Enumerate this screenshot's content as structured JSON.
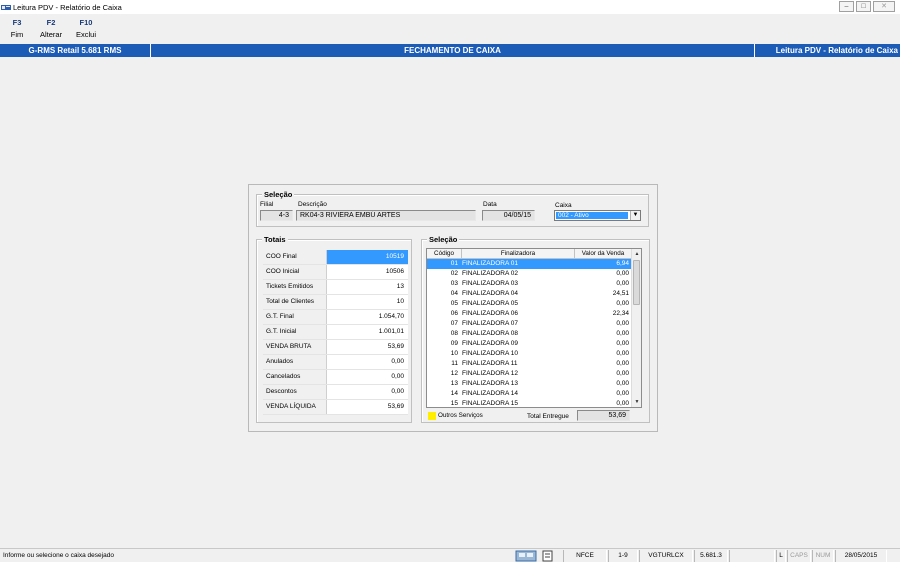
{
  "window": {
    "title": "Leitura PDV - Relatório de Caixa",
    "buttons": [
      "–",
      "□",
      "✕"
    ]
  },
  "toolbar": {
    "items": [
      {
        "key": "F3",
        "label": "Fim"
      },
      {
        "key": "F2",
        "label": "Alterar"
      },
      {
        "key": "F10",
        "label": "Exclui"
      }
    ]
  },
  "header": {
    "left": "G-RMS Retail 5.681 RMS",
    "center": "FECHAMENTO DE CAIXA",
    "right": "Leitura PDV - Relatório de Caixa",
    "color": "#1c5cb6"
  },
  "selecao_top": {
    "title": "Seleção",
    "filial_label": "Filial",
    "filial_value": "4-3",
    "descricao_label": "Descrição",
    "descricao_value": "RK04-3 RIVIERA EMBÚ ARTES",
    "data_label": "Data",
    "data_value": "04/05/15",
    "caixa_label": "Caixa",
    "caixa_value": "002 - Ativo"
  },
  "totais": {
    "title": "Totais",
    "rows": [
      {
        "label": "COO Final",
        "value": "10519"
      },
      {
        "label": "COO Inicial",
        "value": "10506"
      },
      {
        "label": "Tickets Emitidos",
        "value": "13"
      },
      {
        "label": "Total de Clientes",
        "value": "10"
      },
      {
        "label": "G.T. Final",
        "value": "1.054,70"
      },
      {
        "label": "G.T. Inicial",
        "value": "1.001,01"
      },
      {
        "label": "VENDA BRUTA",
        "value": "53,69"
      },
      {
        "label": "Anulados",
        "value": "0,00"
      },
      {
        "label": "Cancelados",
        "value": "0,00"
      },
      {
        "label": "Descontos",
        "value": "0,00"
      },
      {
        "label": "VENDA LÍQUIDA",
        "value": "53,69"
      }
    ]
  },
  "selecao_grid": {
    "title": "Seleção",
    "columns": [
      "Código",
      "Finalizadora",
      "Valor da Venda"
    ],
    "rows": [
      [
        "01",
        "FINALIZADORA 01",
        "6,94"
      ],
      [
        "02",
        "FINALIZADORA 02",
        "0,00"
      ],
      [
        "03",
        "FINALIZADORA 03",
        "0,00"
      ],
      [
        "04",
        "FINALIZADORA 04",
        "24,51"
      ],
      [
        "05",
        "FINALIZADORA 05",
        "0,00"
      ],
      [
        "06",
        "FINALIZADORA 06",
        "22,34"
      ],
      [
        "07",
        "FINALIZADORA 07",
        "0,00"
      ],
      [
        "08",
        "FINALIZADORA 08",
        "0,00"
      ],
      [
        "09",
        "FINALIZADORA 09",
        "0,00"
      ],
      [
        "10",
        "FINALIZADORA 10",
        "0,00"
      ],
      [
        "11",
        "FINALIZADORA 11",
        "0,00"
      ],
      [
        "12",
        "FINALIZADORA 12",
        "0,00"
      ],
      [
        "13",
        "FINALIZADORA 13",
        "0,00"
      ],
      [
        "14",
        "FINALIZADORA 14",
        "0,00"
      ],
      [
        "15",
        "FINALIZADORA 15",
        "0,00"
      ]
    ],
    "legend": "Outros Serviços",
    "legend_color": "#ffee00",
    "total_label": "Total Entregue",
    "total_value": "53,69"
  },
  "statusbar": {
    "message": "Informe ou selecione o caixa desejado",
    "cells": [
      "NFCE",
      "1-9",
      "VGTURLCX",
      "5.681.3",
      "",
      "L",
      "CAPS",
      "NUM",
      "28/05/2015"
    ]
  }
}
